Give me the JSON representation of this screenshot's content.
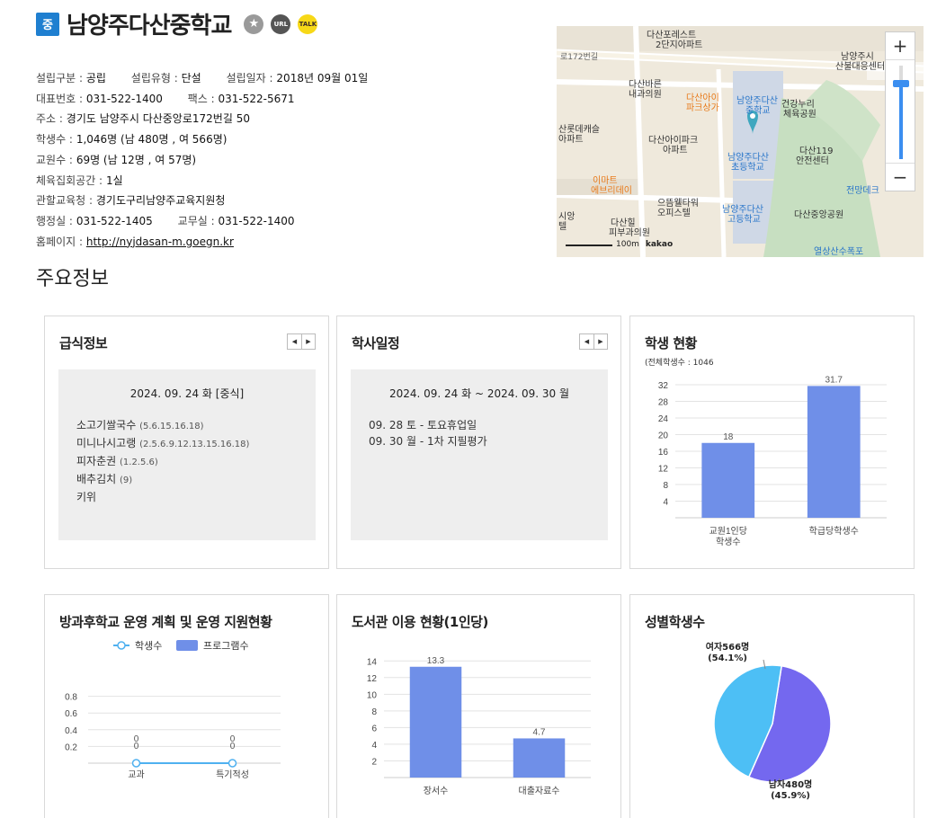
{
  "header": {
    "badge": "중",
    "name": "남양주다산중학교",
    "star_icon": "star-icon",
    "url_label": "URL",
    "talk_label": "TALK"
  },
  "info": {
    "found_type_label": "설립구분 :",
    "found_type": "공립",
    "school_type_label": "설립유형 :",
    "school_type": "단설",
    "found_date_label": "설립일자 :",
    "found_date": "2018년 09월 01일",
    "phone_label": "대표번호 :",
    "phone": "031-522-1400",
    "fax_label": "팩스 :",
    "fax": "031-522-5671",
    "address_label": "주소 :",
    "address": "경기도 남양주시 다산중앙로172번길 50",
    "students_label": "학생수 :",
    "students": "1,046명 (남 480명 , 여 566명)",
    "teachers_label": "교원수 :",
    "teachers": "69명 (남 12명 , 여 57명)",
    "gym_label": "체육집회공간 :",
    "gym": "1실",
    "office_label": "관할교육청 :",
    "office": "경기도구리남양주교육지원청",
    "admin_label": "행정실 :",
    "admin": "031-522-1405",
    "staff_label": "교무실 :",
    "staff": "031-522-1400",
    "homepage_label": "홈페이지 :",
    "homepage": "http://nyjdasan-m.goegn.kr"
  },
  "section_title": "주요정보",
  "map": {
    "labels": {
      "l1": "다산포레스트",
      "l1b": "2단지아파트",
      "l2": "남양주시",
      "l2b": "산불대응센터",
      "l3": "다산바른",
      "l3b": "내과의원",
      "l4": "다산아이",
      "l4b": "파크상가",
      "l5": "남양주다산",
      "l5b": "중학교",
      "l6": "건강누리",
      "l6b": "체육공원",
      "l7": "산롯데캐슬",
      "l7b": "아파트",
      "l8": "다산아이파크",
      "l8b": "아파트",
      "l9": "남양주다산",
      "l9b": "초등학교",
      "l10": "다산119",
      "l10b": "안전센터",
      "l11": "이마트",
      "l11b": "에브리데이",
      "l12": "으뜸웰타워",
      "l12b": "오피스텔",
      "l13": "남양주다산",
      "l13b": "고등학교",
      "l14": "전망데크",
      "l15": "다산중앙공원",
      "l16": "다산힐",
      "l16b": "피부과의원",
      "l17": "열상산수폭포",
      "l18": "로172번길",
      "l19": "시앙",
      "l19b": "텔",
      "scale": "100m",
      "brand": "kakao"
    },
    "zoom_in": "+",
    "zoom_out": "−"
  },
  "cards": {
    "meal": {
      "title": "급식정보",
      "date": "2024. 09. 24 화 [중식]",
      "items": [
        {
          "name": "소고기쌀국수",
          "allergy": "(5.6.15.16.18)"
        },
        {
          "name": "미니나시고랭",
          "allergy": "(2.5.6.9.12.13.15.16.18)"
        },
        {
          "name": "피자춘권",
          "allergy": "(1.2.5.6)"
        },
        {
          "name": "배추김치",
          "allergy": "(9)"
        },
        {
          "name": "키위",
          "allergy": ""
        }
      ]
    },
    "schedule": {
      "title": "학사일정",
      "range": "2024. 09. 24 화 ~ 2024. 09. 30 월",
      "items": [
        "09. 28 토 - 토요휴업일",
        "09. 30 월 - 1차 지필평가"
      ]
    },
    "students": {
      "title": "학생 현황",
      "subtitle": "(전체학생수 : 1046"
    },
    "afterschool": {
      "title": "방과후학교 운영 계획 및 운영 지원현황"
    },
    "library": {
      "title": "도서관 이용 현황(1인당)"
    },
    "gender": {
      "title": "성별학생수"
    }
  },
  "chart_data": [
    {
      "type": "bar",
      "categories": [
        "교원1인당\n학생수",
        "학급당학생수"
      ],
      "values": [
        18,
        31.7
      ],
      "ylim": [
        0,
        32
      ],
      "yticks": [
        4,
        8,
        12,
        16,
        20,
        24,
        28,
        32
      ],
      "color": "#6f8fe8"
    },
    {
      "type": "line",
      "categories": [
        "교과",
        "특기적성"
      ],
      "series": [
        {
          "name": "학생수",
          "values": [
            0,
            0
          ],
          "color": "#4fb1f0"
        },
        {
          "name": "프로그램수",
          "values": [
            0,
            0
          ],
          "color": "#6f8fe8"
        }
      ],
      "ylim": [
        0,
        1
      ],
      "yticks": [
        0.2,
        0.4,
        0.6,
        0.8
      ],
      "legend": "top"
    },
    {
      "type": "bar",
      "categories": [
        "장서수",
        "대출자료수"
      ],
      "values": [
        13.3,
        4.7
      ],
      "ylim": [
        0,
        15
      ],
      "yticks": [
        2,
        4,
        6,
        8,
        10,
        12,
        14
      ],
      "color": "#6f8fe8"
    },
    {
      "type": "pie",
      "slices": [
        {
          "label": "여자566명",
          "pct": "(54.1%)",
          "value": 566,
          "color": "#7468ef"
        },
        {
          "label": "남자480명",
          "pct": "(45.9%)",
          "value": 480,
          "color": "#4dbff5"
        }
      ]
    }
  ]
}
